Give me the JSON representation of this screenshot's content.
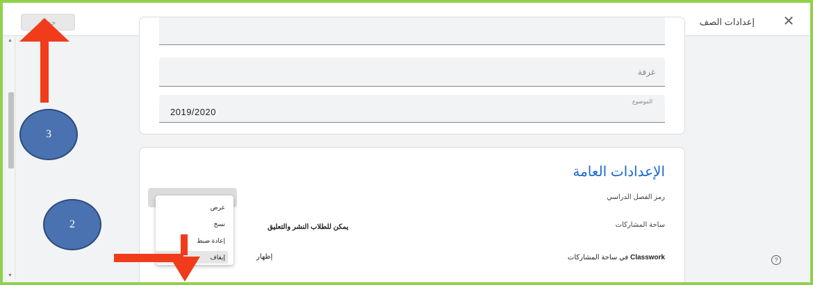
{
  "header": {
    "save_label": "حفظ",
    "title": "إعدادات الصف",
    "close_icon": "close-icon"
  },
  "class_details": {
    "room_label": "غرفة",
    "subject_label": "الموضوع",
    "subject_value": "2019/2020"
  },
  "general": {
    "title": "الإعدادات العامة",
    "class_code_label": "رمز الفصل الدراسي",
    "stream_label": "ساحة المشاركات",
    "stream_value": "يمكن للطلاب النشر والتعليق",
    "classwork_label_brand": "Classwork",
    "classwork_label_rest": " في ساحة المشاركات",
    "classwork_value": "إظهار"
  },
  "code_menu": {
    "items": [
      "عرض",
      "نسخ",
      "إعادة ضبط",
      "إيقاف"
    ],
    "highlighted": "إيقاف"
  },
  "annotations": {
    "badge_3": "3",
    "badge_2": "2",
    "arrow_color": "#f03c1a",
    "badge_color": "#4a72b0",
    "border_color": "#8fd24a"
  },
  "icons": {
    "help": "help-icon",
    "close": "close-icon"
  }
}
